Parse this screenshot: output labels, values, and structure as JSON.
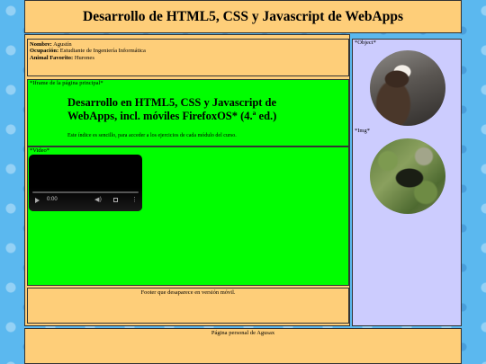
{
  "header": {
    "title": "Desarrollo de HTML5, CSS y Javascript de WebApps"
  },
  "info": {
    "name_label": "Nombre:",
    "name_value": "Agustín",
    "occupation_label": "Ocupación:",
    "occupation_value": "Estudiante de Ingeniería Informática",
    "animal_label": "Animal Favorito:",
    "animal_value": "Hurones"
  },
  "frame": {
    "label": "*Iframe de la página principal*",
    "title": "Desarrollo en HTML5, CSS y Javascript de WebApps, incl. móviles FirefoxOS* (4.ª ed.)",
    "subtitle": "Este índice es sencillo, para acceder a los ejercicios de cada módulo del curso."
  },
  "video": {
    "label": "*Video*",
    "time": "0:00"
  },
  "footer": {
    "text": "Footer que desaparece en versión móvil."
  },
  "sidebar": {
    "object_label": "*Object*",
    "img_label": "*Img*"
  },
  "page_footer": {
    "text": "Página personal de Agusax"
  },
  "colors": {
    "header_bg": "#fece79",
    "frame_bg": "#00fe00",
    "sidebar_bg": "#ccccfe",
    "page_bg": "#5bb8ef"
  },
  "icons": [
    "play-icon",
    "volume-icon",
    "fullscreen-icon",
    "menu-icon"
  ]
}
